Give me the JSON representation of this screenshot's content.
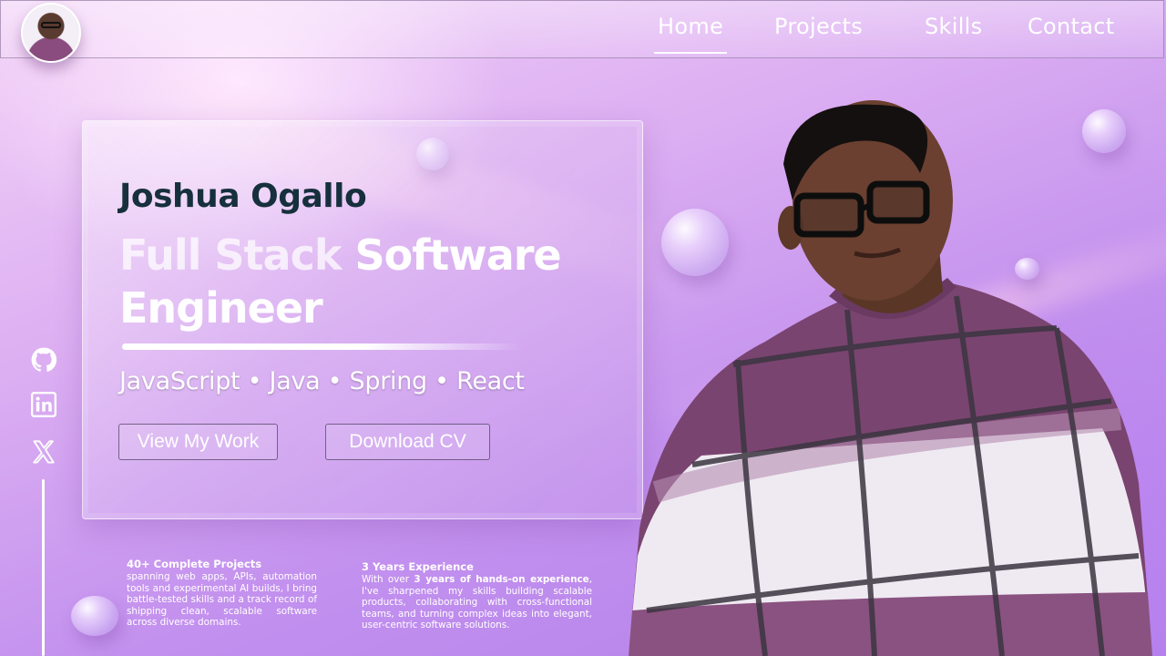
{
  "nav": {
    "links": [
      {
        "label": "Home",
        "active": true
      },
      {
        "label": "Projects",
        "active": false
      },
      {
        "label": "Skills",
        "active": false
      },
      {
        "label": "Contact",
        "active": false
      }
    ]
  },
  "hero": {
    "name": "Joshua Ogallo",
    "role_part1": "Full Stack",
    "role_part2": "Software Engineer",
    "tech_stack": "JavaScript • Java • Spring • React",
    "buttons": {
      "view_work": "View My Work",
      "download_cv": "Download CV"
    }
  },
  "social": [
    "github-icon",
    "linkedin-icon",
    "x-icon"
  ],
  "stats": [
    {
      "title": "40+ Complete Projects",
      "body": "spanning web apps, APIs, automation tools and experimental AI builds, I bring battle-tested skills and a track record of shipping clean, scalable software across diverse domains."
    },
    {
      "title": "3 Years Experience",
      "body_prefix": "With over ",
      "body_bold": "3 years of hands-on experience",
      "body_suffix": ", I've sharpened my skills building scalable products, collaborating with cross-functional teams, and turning complex ideas into elegant, user-centric software solutions."
    }
  ],
  "colors": {
    "name": "#16303d",
    "background_start": "#f2d2f7",
    "background_end": "#b280ea",
    "sweater": "#7a4470"
  }
}
